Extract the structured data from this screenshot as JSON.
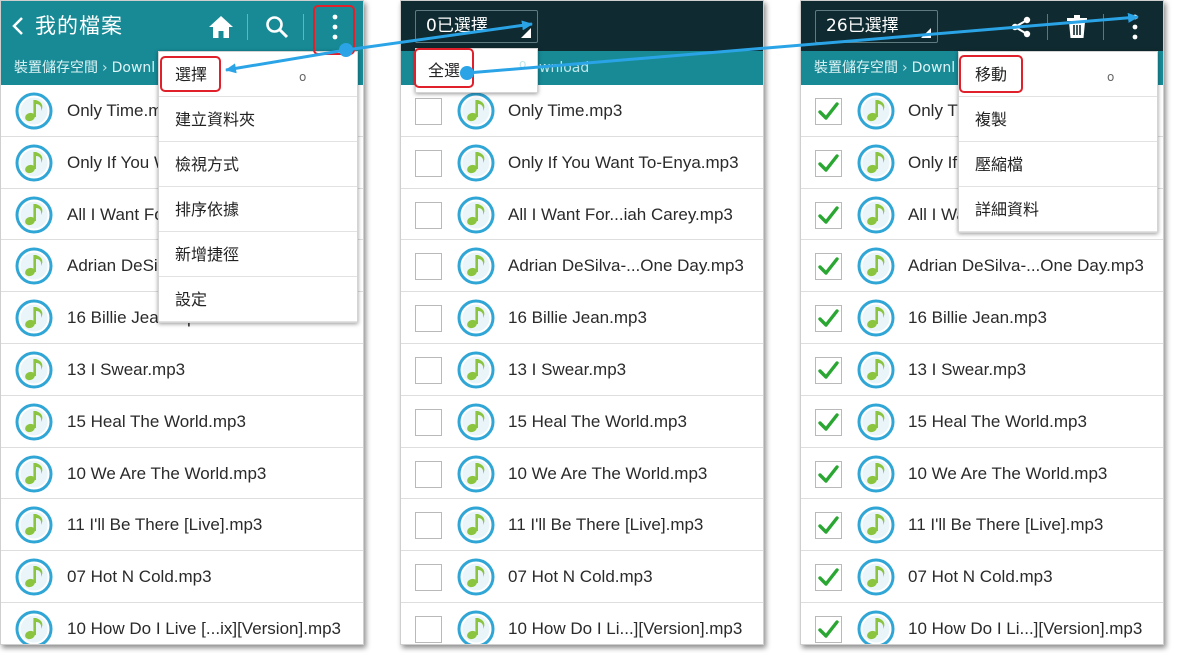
{
  "panel1": {
    "title": "我的檔案",
    "breadcrumb": {
      "root": "裝置儲存空間",
      "sub": "Downl"
    },
    "menu": [
      "選擇",
      "建立資料夾",
      "檢視方式",
      "排序依據",
      "新增捷徑",
      "設定"
    ],
    "files": [
      "Only Time.mp3",
      "Only If You Want To-Enya.mp3",
      "All I Want For...iah Carey.mp3",
      "Adrian DeSilva-...One Day.mp3",
      "16 Billie Jean.mp3",
      "13 I Swear.mp3",
      "15 Heal The World.mp3",
      "10 We Are The World.mp3",
      "11 I'll Be There [Live].mp3",
      "07 Hot N Cold.mp3",
      "10 How Do I Live [...ix][Version].mp3"
    ]
  },
  "panel2": {
    "counter": "0已選擇",
    "breadcrumb_tail": "wnload",
    "select_all": "全選",
    "files": [
      "Only Time.mp3",
      "Only If You Want To-Enya.mp3",
      "All I Want For...iah Carey.mp3",
      "Adrian DeSilva-...One Day.mp3",
      "16 Billie Jean.mp3",
      "13 I Swear.mp3",
      "15 Heal The World.mp3",
      "10 We Are The World.mp3",
      "11 I'll Be There [Live].mp3",
      "07 Hot N Cold.mp3",
      "10 How Do I Li...][Version].mp3"
    ]
  },
  "panel3": {
    "counter": "26已選擇",
    "breadcrumb": {
      "root": "裝置儲存空間",
      "sub": "Downl"
    },
    "menu": [
      "移動",
      "複製",
      "壓縮檔",
      "詳細資料"
    ],
    "files": [
      "Only Time.mp3",
      "Only If You Want To-Enya.mp3",
      "All I Want For...iah Carey.mp3",
      "Adrian DeSilva-...One Day.mp3",
      "16 Billie Jean.mp3",
      "13 I Swear.mp3",
      "15 Heal The World.mp3",
      "10 We Are The World.mp3",
      "11 I'll Be There [Live].mp3",
      "07 Hot N Cold.mp3",
      "10 How Do I Li...][Version].mp3"
    ]
  },
  "colors": {
    "appbar": "#178a96",
    "appbar_select": "#0f2a30",
    "highlight": "#e0202a",
    "arrow": "#2aa4e6",
    "check": "#2aa632",
    "note_ring": "#2fa6d5",
    "note_fill": "#8bc53f"
  },
  "icons": [
    "back-arrow-icon",
    "home-icon",
    "search-icon",
    "overflow-menu-icon",
    "share-icon",
    "delete-icon",
    "music-note-icon",
    "checkmark-icon"
  ]
}
